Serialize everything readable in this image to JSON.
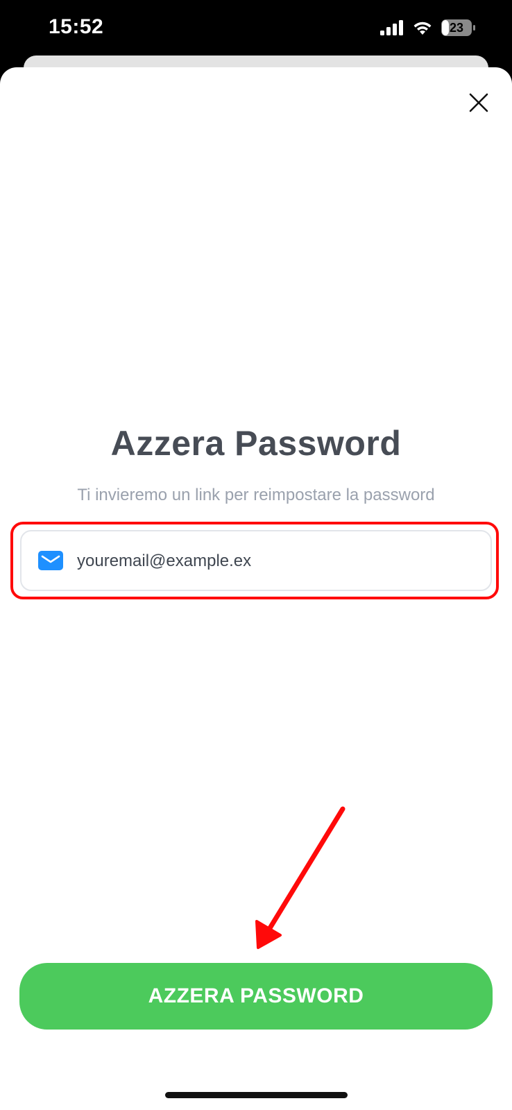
{
  "status_bar": {
    "time": "15:52",
    "battery_level": "23",
    "icons": [
      "signal-icon",
      "wifi-icon",
      "battery-icon"
    ]
  },
  "sheet": {
    "close_icon": "close-icon",
    "title": "Azzera Password",
    "subtitle": "Ti invieremo un link per reimpostare la password",
    "email": {
      "icon": "mail-icon",
      "value": "youremail@example.ex"
    },
    "submit_label": "AZZERA PASSWORD"
  },
  "annotations": {
    "highlight_color": "#ff0a0a",
    "arrow_color": "#ff0a0a"
  },
  "colors": {
    "button_green": "#4cca5c",
    "mail_blue": "#1e90ff",
    "title_gray": "#474c55"
  }
}
